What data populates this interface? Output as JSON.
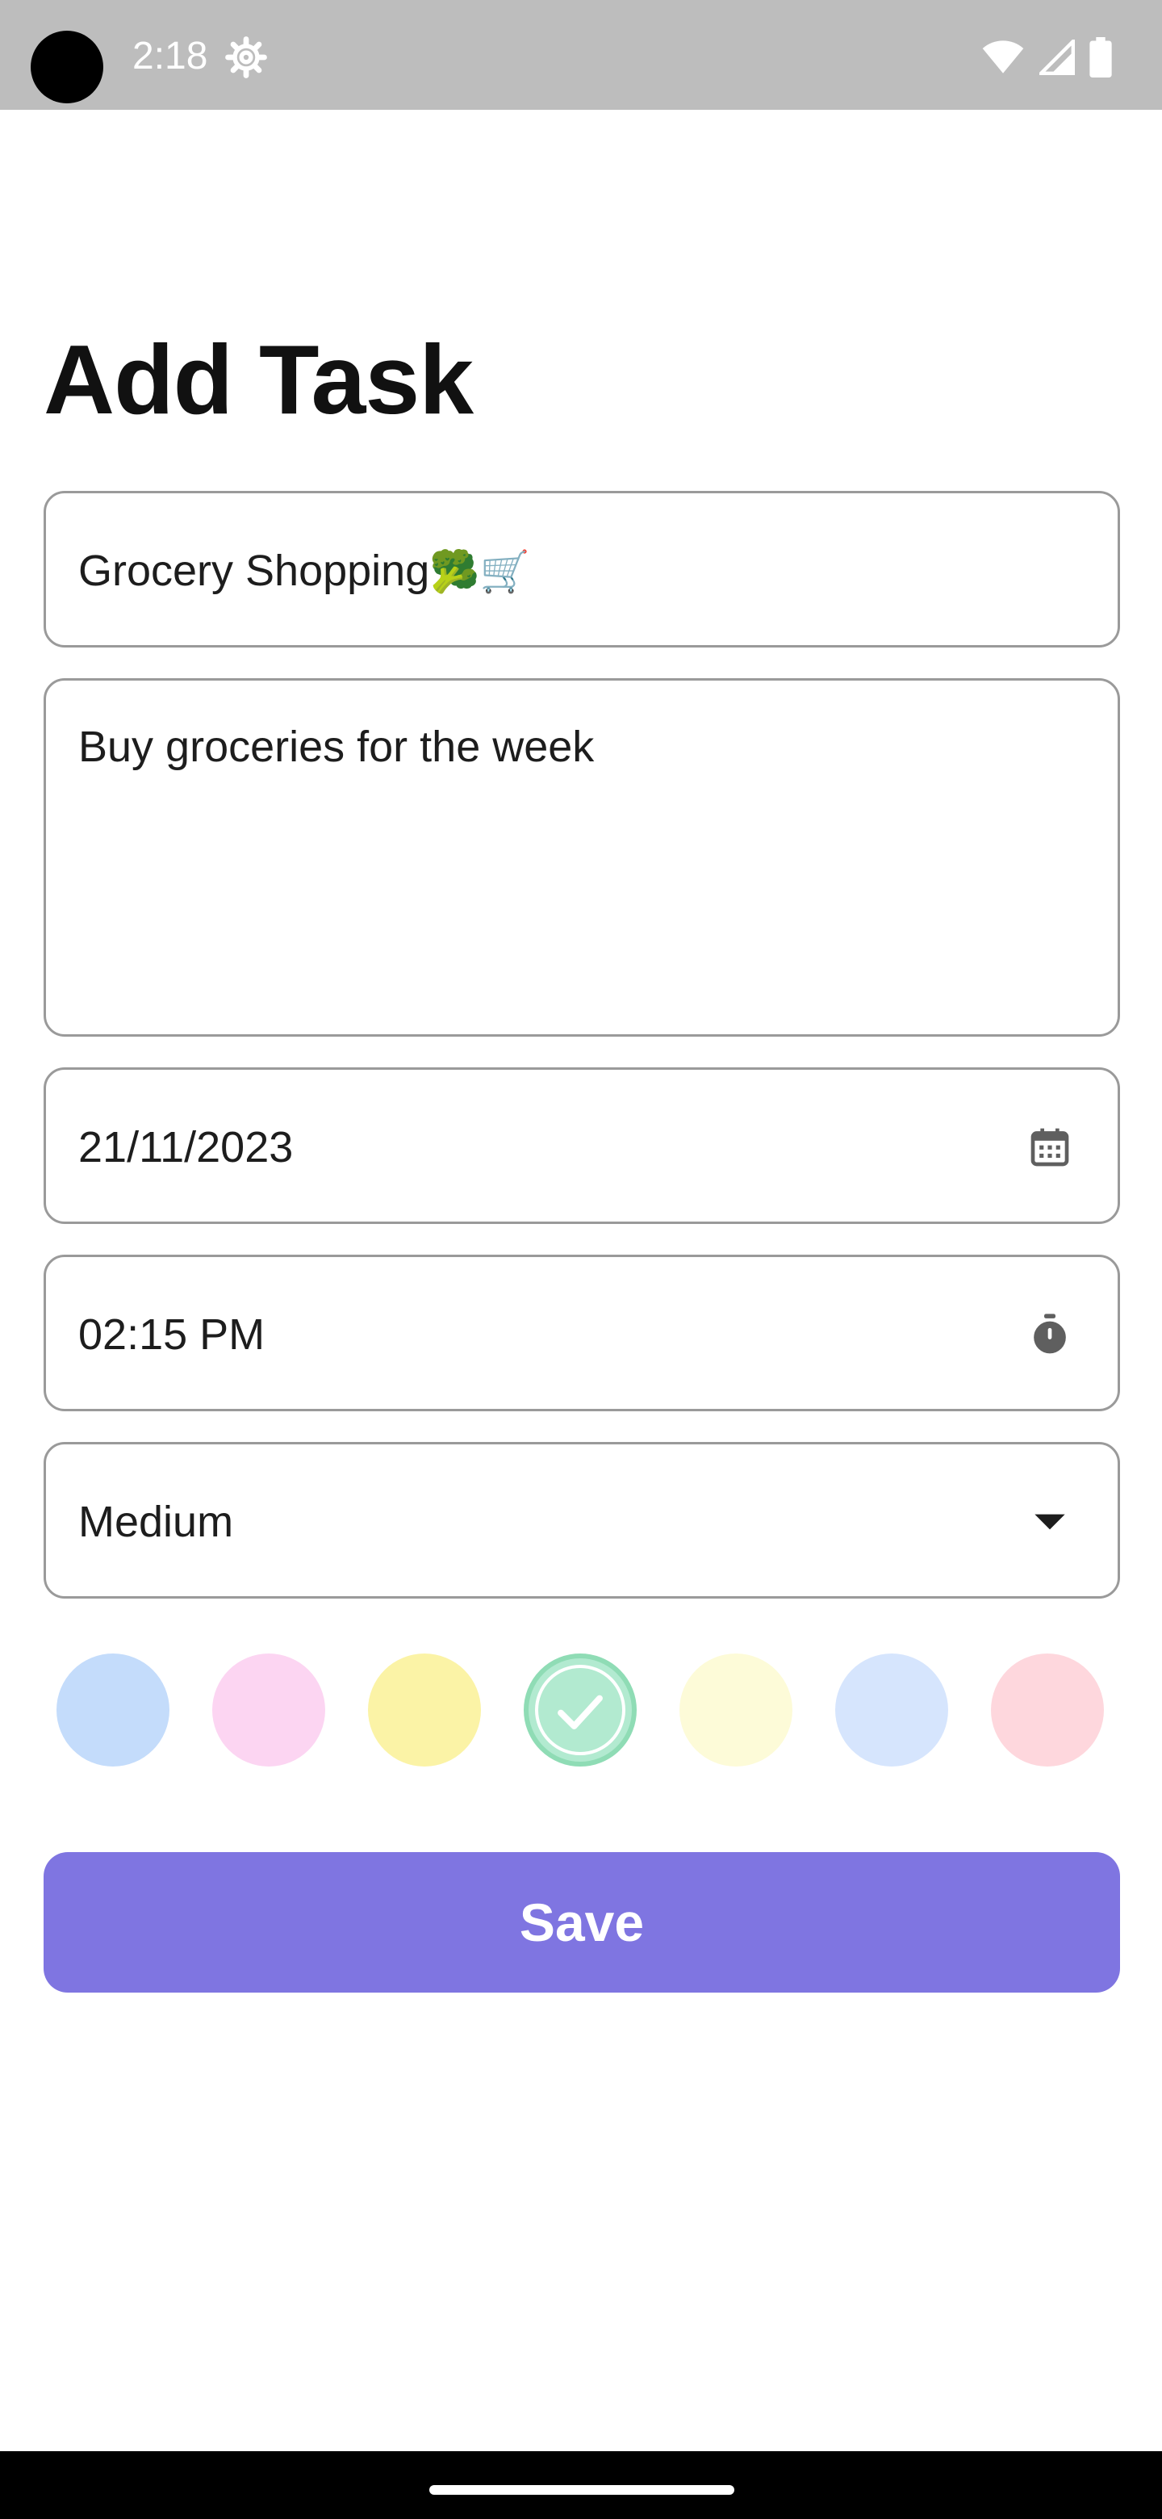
{
  "status_bar": {
    "time": "2:18",
    "icons": [
      "settings-gear-icon",
      "wifi-icon",
      "cellular-signal-icon",
      "battery-icon"
    ],
    "background_color": "#bdbdbd"
  },
  "page": {
    "title": "Add Task"
  },
  "form": {
    "title_value": "Grocery Shopping",
    "title_emojis": "🥦🛒",
    "description_value": "Buy groceries for the week",
    "date_value": "21/11/2023",
    "date_icon": "calendar-icon",
    "time_value": "02:15 PM",
    "time_icon": "stopwatch-icon",
    "priority_value": "Medium",
    "priority_icon": "dropdown-arrow-icon"
  },
  "colors": {
    "swatches": [
      "#c4dcfb",
      "#fcd5f2",
      "#fbf3a6",
      "#b2ead0",
      "#fdfbd8",
      "#d6e5fd",
      "#fed7dd"
    ],
    "selected_index": 3,
    "selected_icon": "checkmark-icon",
    "accent": "#7f75e1"
  },
  "actions": {
    "save_label": "Save"
  }
}
